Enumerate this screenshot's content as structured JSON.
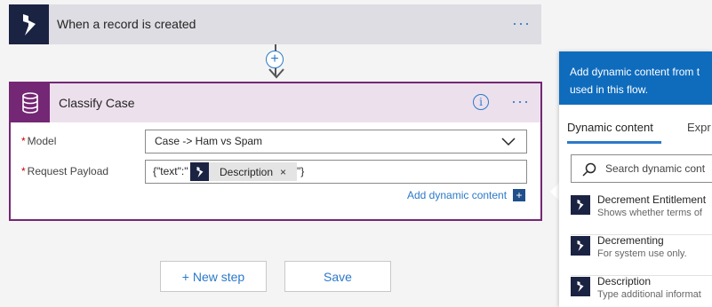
{
  "trigger": {
    "title": "When a record is created",
    "more": "···"
  },
  "connector": {
    "add": "+"
  },
  "action": {
    "title": "Classify Case",
    "info": "i",
    "more": "···",
    "model_label": "Model",
    "model_value": "Case -> Ham vs Spam",
    "payload_label": "Request Payload",
    "payload_prefix": "{\"text\":\"",
    "payload_token": "Description",
    "payload_token_close": "×",
    "payload_suffix": "\"}",
    "required_mark": "*",
    "add_dynamic": "Add dynamic content",
    "add_dynamic_icon": "+"
  },
  "buttons": {
    "new_step": "+ New step",
    "save": "Save"
  },
  "panel": {
    "header_line1": "Add dynamic content from t",
    "header_line2": "used in this flow.",
    "tab_dynamic": "Dynamic content",
    "tab_expression": "Expr",
    "search_placeholder": "Search dynamic cont",
    "items": [
      {
        "name": "Decrement Entitlement",
        "desc": "Shows whether terms of"
      },
      {
        "name": "Decrementing",
        "desc": "For system use only."
      },
      {
        "name": "Description",
        "desc": "Type additional informat"
      }
    ]
  },
  "colors": {
    "dynamics": "#1b2343",
    "action": "#742774",
    "accent": "#2b79c9",
    "panel_header": "#0f6cbd"
  }
}
